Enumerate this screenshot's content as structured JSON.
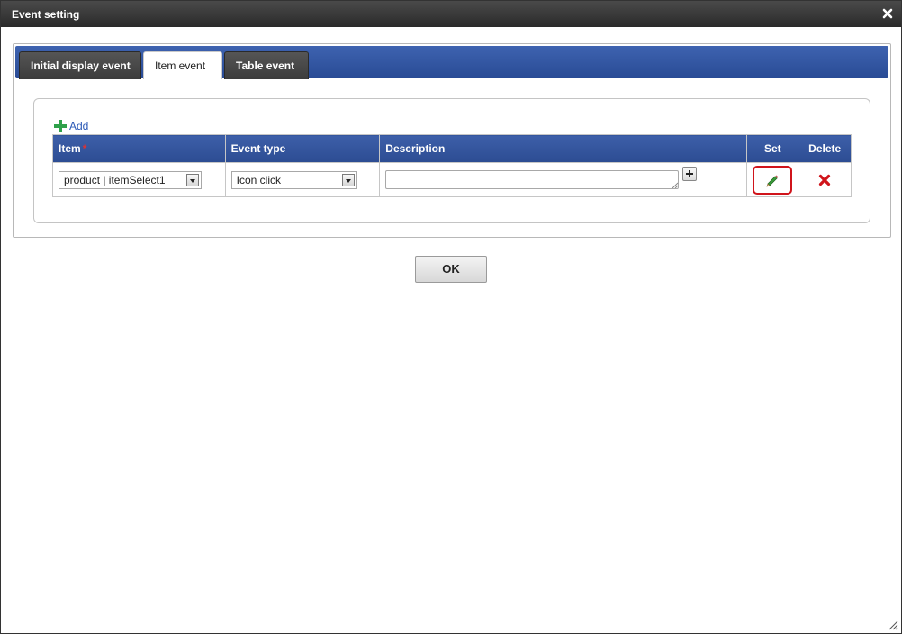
{
  "dialog": {
    "title": "Event setting",
    "close_icon": "close-icon"
  },
  "tabs": [
    {
      "label": "Initial display event",
      "active": false
    },
    {
      "label": "Item event",
      "active": true
    },
    {
      "label": "Table event",
      "active": false
    }
  ],
  "add_link": {
    "label": "Add",
    "icon": "plus-icon"
  },
  "table": {
    "headers": {
      "item": "Item",
      "required_mark": "*",
      "event_type": "Event type",
      "description": "Description",
      "set": "Set",
      "delete": "Delete"
    },
    "rows": [
      {
        "item": "product | itemSelect1",
        "event_type": "Icon click",
        "description": "",
        "set_icon": "pencil-icon",
        "delete_icon": "delete-x-icon"
      }
    ]
  },
  "ok_button": {
    "label": "OK"
  },
  "colors": {
    "tabbar": "#2c4c92",
    "header": "#2c4c92",
    "highlight": "#d0141b",
    "delete": "#d0141b",
    "add_icon": "#2fa14a"
  }
}
